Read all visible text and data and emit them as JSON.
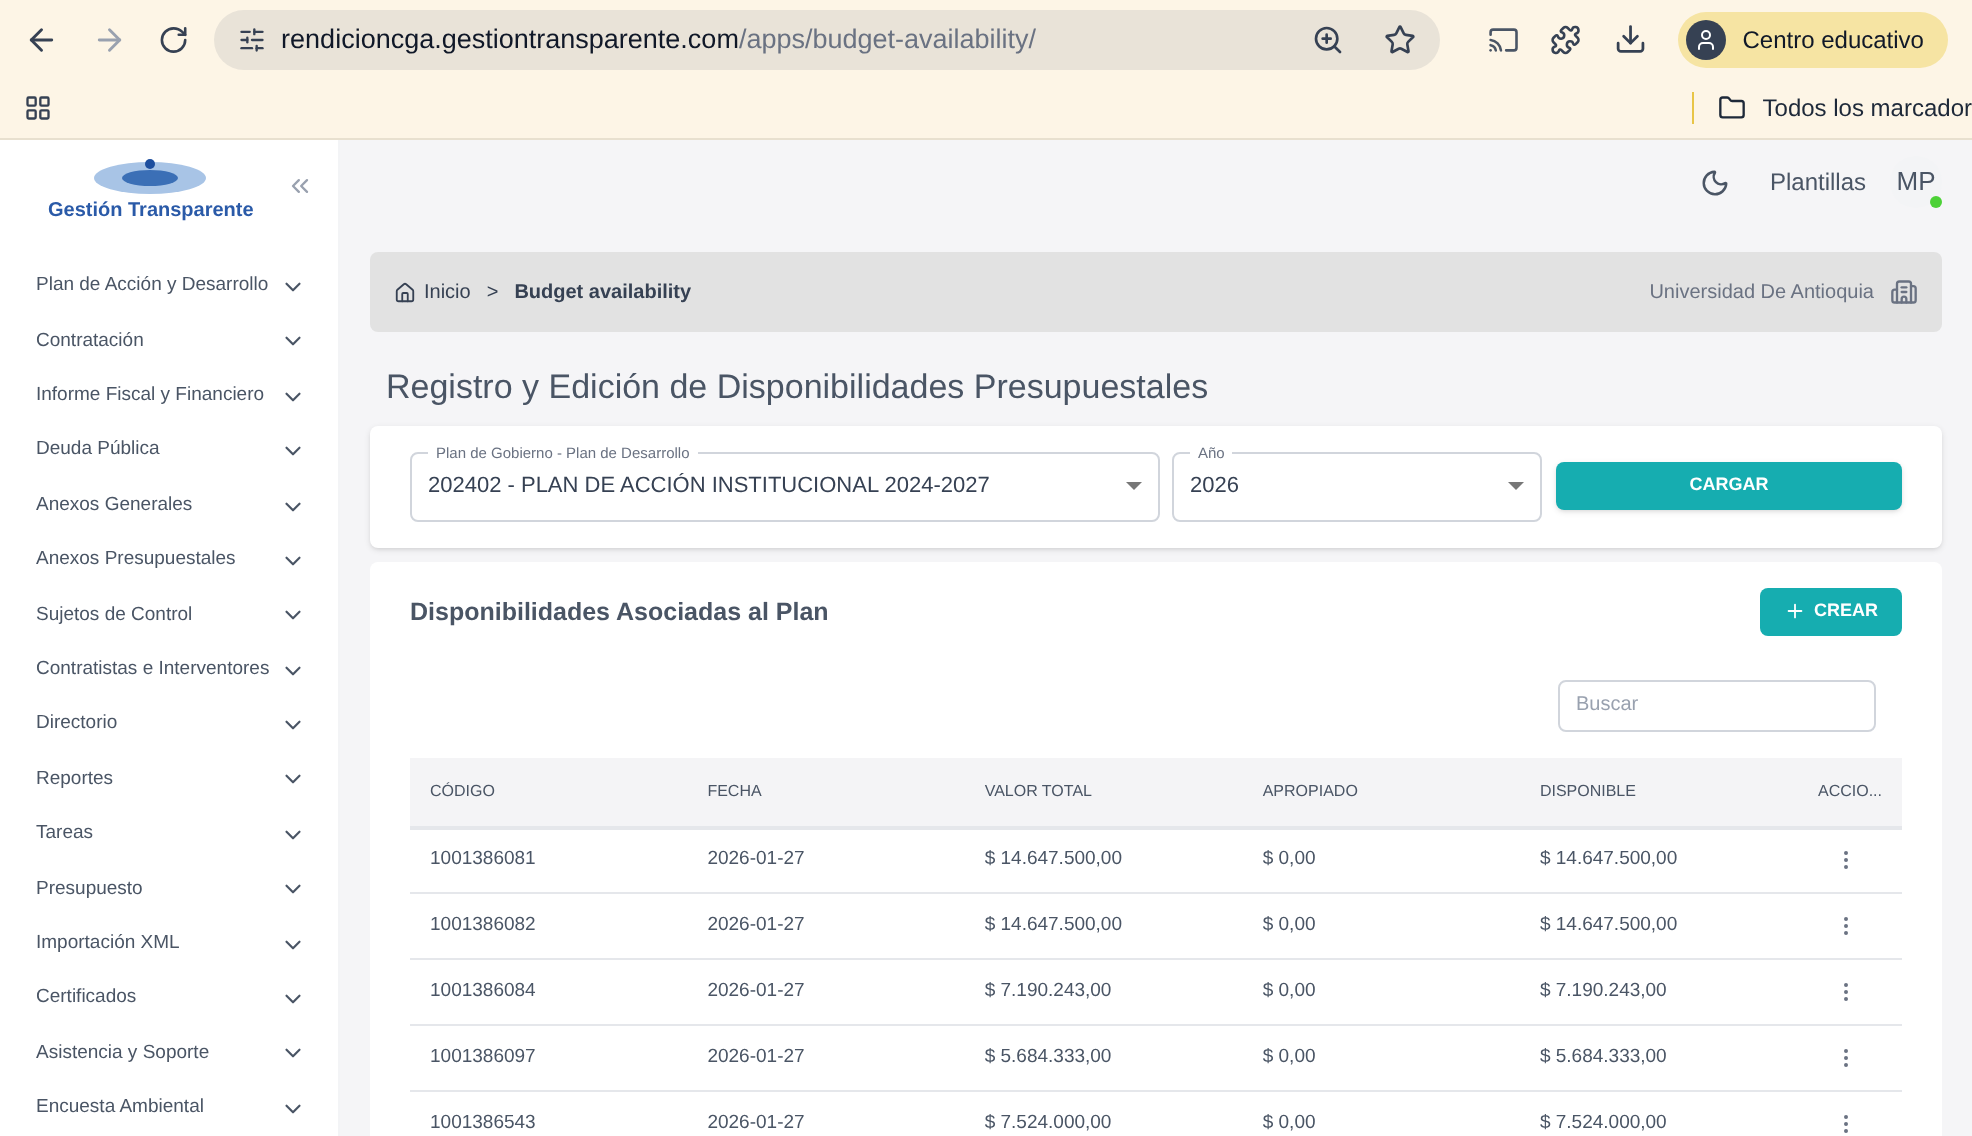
{
  "browser": {
    "url_host": "rendicioncga.gestiontransparente.com",
    "url_path": "/apps/budget-availability/",
    "profile": "Centro educativo",
    "bookmarks": "Todos los marcador"
  },
  "sidebar": {
    "logo": "Gestión Transparente",
    "items": [
      {
        "label": "Plan de Acción y Desarrollo",
        "expanded": false
      },
      {
        "label": "Contratación",
        "expanded": false
      },
      {
        "label": "Informe Fiscal y Financiero",
        "expanded": false
      },
      {
        "label": "Deuda Pública",
        "expanded": false
      },
      {
        "label": "Anexos Generales",
        "expanded": false
      },
      {
        "label": "Anexos Presupuestales",
        "expanded": false
      },
      {
        "label": "Sujetos de Control",
        "expanded": false
      },
      {
        "label": "Contratistas e Interventores",
        "expanded": false
      },
      {
        "label": "Directorio",
        "expanded": false
      },
      {
        "label": "Reportes",
        "expanded": false
      },
      {
        "label": "Tareas",
        "expanded": false
      },
      {
        "label": "Presupuesto",
        "expanded": false
      },
      {
        "label": "Importación XML",
        "expanded": false
      },
      {
        "label": "Certificados",
        "expanded": false
      },
      {
        "label": "Asistencia y Soporte",
        "expanded": false
      },
      {
        "label": "Encuesta Ambiental",
        "expanded": false
      }
    ]
  },
  "topbar": {
    "templates": "Plantillas",
    "avatar": "MP"
  },
  "breadcrumb": {
    "home": "Inicio",
    "separator": ">",
    "current": "Budget availability",
    "entity": "Universidad De Antioquia"
  },
  "page_title": "Registro y Edición de Disponibilidades Presupuestales",
  "filters": {
    "plan": {
      "label": "Plan de Gobierno - Plan de Desarrollo",
      "value": "202402 - PLAN DE ACCIÓN INSTITUCIONAL 2024-2027"
    },
    "year": {
      "label": "Año",
      "value": "2026"
    },
    "load_button": "CARGAR"
  },
  "table_card": {
    "title": "Disponibilidades Asociadas al Plan",
    "create_button": "CREAR",
    "search": {
      "placeholder": "Buscar"
    },
    "columns": [
      "CÓDIGO",
      "FECHA",
      "VALOR TOTAL",
      "APROPIADO",
      "DISPONIBLE",
      "ACCIO..."
    ],
    "rows": [
      [
        "1001386081",
        "2026-01-27",
        "$ 14.647.500,00",
        "$ 0,00",
        "$ 14.647.500,00"
      ],
      [
        "1001386082",
        "2026-01-27",
        "$ 14.647.500,00",
        "$ 0,00",
        "$ 14.647.500,00"
      ],
      [
        "1001386084",
        "2026-01-27",
        "$ 7.190.243,00",
        "$ 0,00",
        "$ 7.190.243,00"
      ],
      [
        "1001386097",
        "2026-01-27",
        "$ 5.684.333,00",
        "$ 0,00",
        "$ 5.684.333,00"
      ],
      [
        "1001386543",
        "2026-01-27",
        "$ 7.524.000,00",
        "$ 0,00",
        "$ 7.524.000,00"
      ]
    ]
  }
}
